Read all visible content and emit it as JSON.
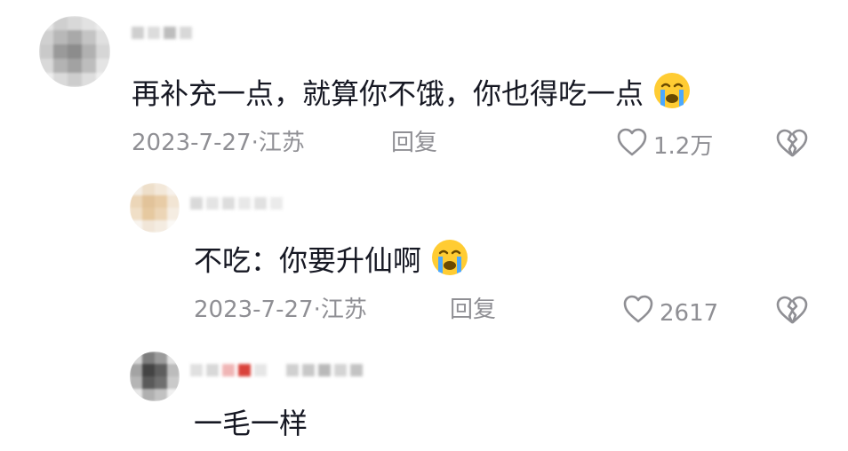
{
  "comments": [
    {
      "text": "再补充一点，就算你不饿，你也得吃一点",
      "emoji": "loudly-crying-face",
      "date": "2023-7-27",
      "location": "江苏",
      "reply_label": "回复",
      "likes": "1.2万"
    },
    {
      "text": "不吃：你要升仙啊",
      "emoji": "loudly-crying-face",
      "date": "2023-7-27",
      "location": "江苏",
      "reply_label": "回复",
      "likes": "2617"
    },
    {
      "text": "一毛一样"
    }
  ],
  "icons": {
    "like": "heart-outline-icon",
    "dislike": "broken-heart-icon"
  },
  "colors": {
    "text": "#161823",
    "meta": "#8f8f94",
    "emoji_face": "#ffcc33",
    "emoji_tears": "#4aa8ff"
  }
}
